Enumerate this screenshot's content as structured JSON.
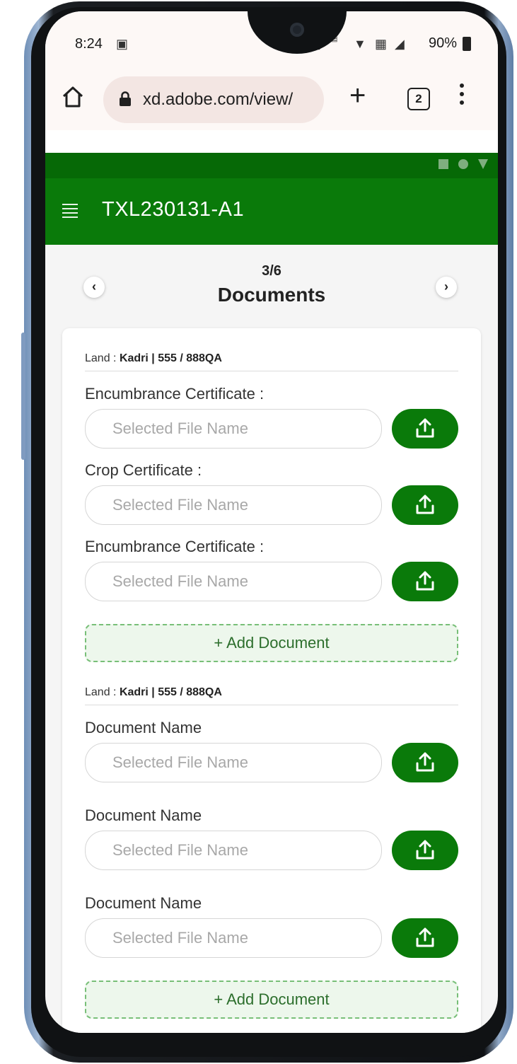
{
  "status_bar": {
    "time": "8:24",
    "battery": "90%"
  },
  "browser": {
    "url": "xd.adobe.com/view/",
    "tab_count": "2"
  },
  "app": {
    "title": "TXL230131-A1"
  },
  "stepper": {
    "step": "3/6",
    "title": "Documents",
    "prev": "‹",
    "next": "›"
  },
  "sections": [
    {
      "land_prefix": "Land : ",
      "land_value": "Kadri | 555 / 888QA",
      "documents": [
        {
          "label": "Encumbrance Certificate :",
          "placeholder": "Selected File Name"
        },
        {
          "label": "Crop Certificate :",
          "placeholder": "Selected File Name"
        },
        {
          "label": "Encumbrance Certificate :",
          "placeholder": "Selected File Name"
        }
      ],
      "add_label": "+ Add Document"
    },
    {
      "land_prefix": "Land : ",
      "land_value": "Kadri | 555 / 888QA",
      "documents": [
        {
          "label": "Document Name",
          "placeholder": "Selected File Name"
        },
        {
          "label": "Document Name",
          "placeholder": "Selected File Name"
        },
        {
          "label": "Document Name",
          "placeholder": "Selected File Name"
        }
      ],
      "add_label": "+ Add Document"
    }
  ],
  "colors": {
    "primary_green": "#0a7a0a",
    "header_dark_green": "#066906",
    "dashed_border": "#78bf78"
  }
}
